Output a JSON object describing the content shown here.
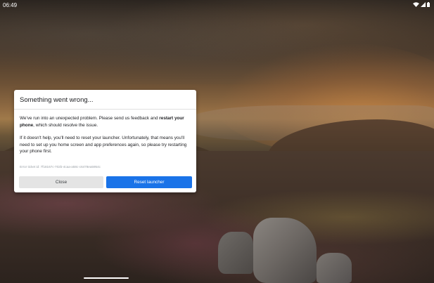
{
  "status_bar": {
    "time": "06:49",
    "icons": [
      "wifi-icon",
      "signal-icon",
      "battery-icon"
    ]
  },
  "dialog": {
    "title": "Something went wrong...",
    "paragraph1_prefix": "We've run into an unexpected problem. Please send us feedback and ",
    "paragraph1_bold": "restart your phone",
    "paragraph1_suffix": ", which should resolve the issue.",
    "paragraph2": "If it doesn't help, you'll need to reset your launcher. Unfortunately, that means you'll need to set up you home screen and app preferences again, so please try restarting your phone first.",
    "error_ticket": "Error ticket id: 7f18167c-702b-4caa-a58c-c6478ea5954c",
    "close_label": "Close",
    "reset_label": "Reset launcher"
  },
  "colors": {
    "accent": "#1a73e8",
    "secondary_button": "#e4e4e4",
    "dialog_bg": "#ffffff"
  }
}
